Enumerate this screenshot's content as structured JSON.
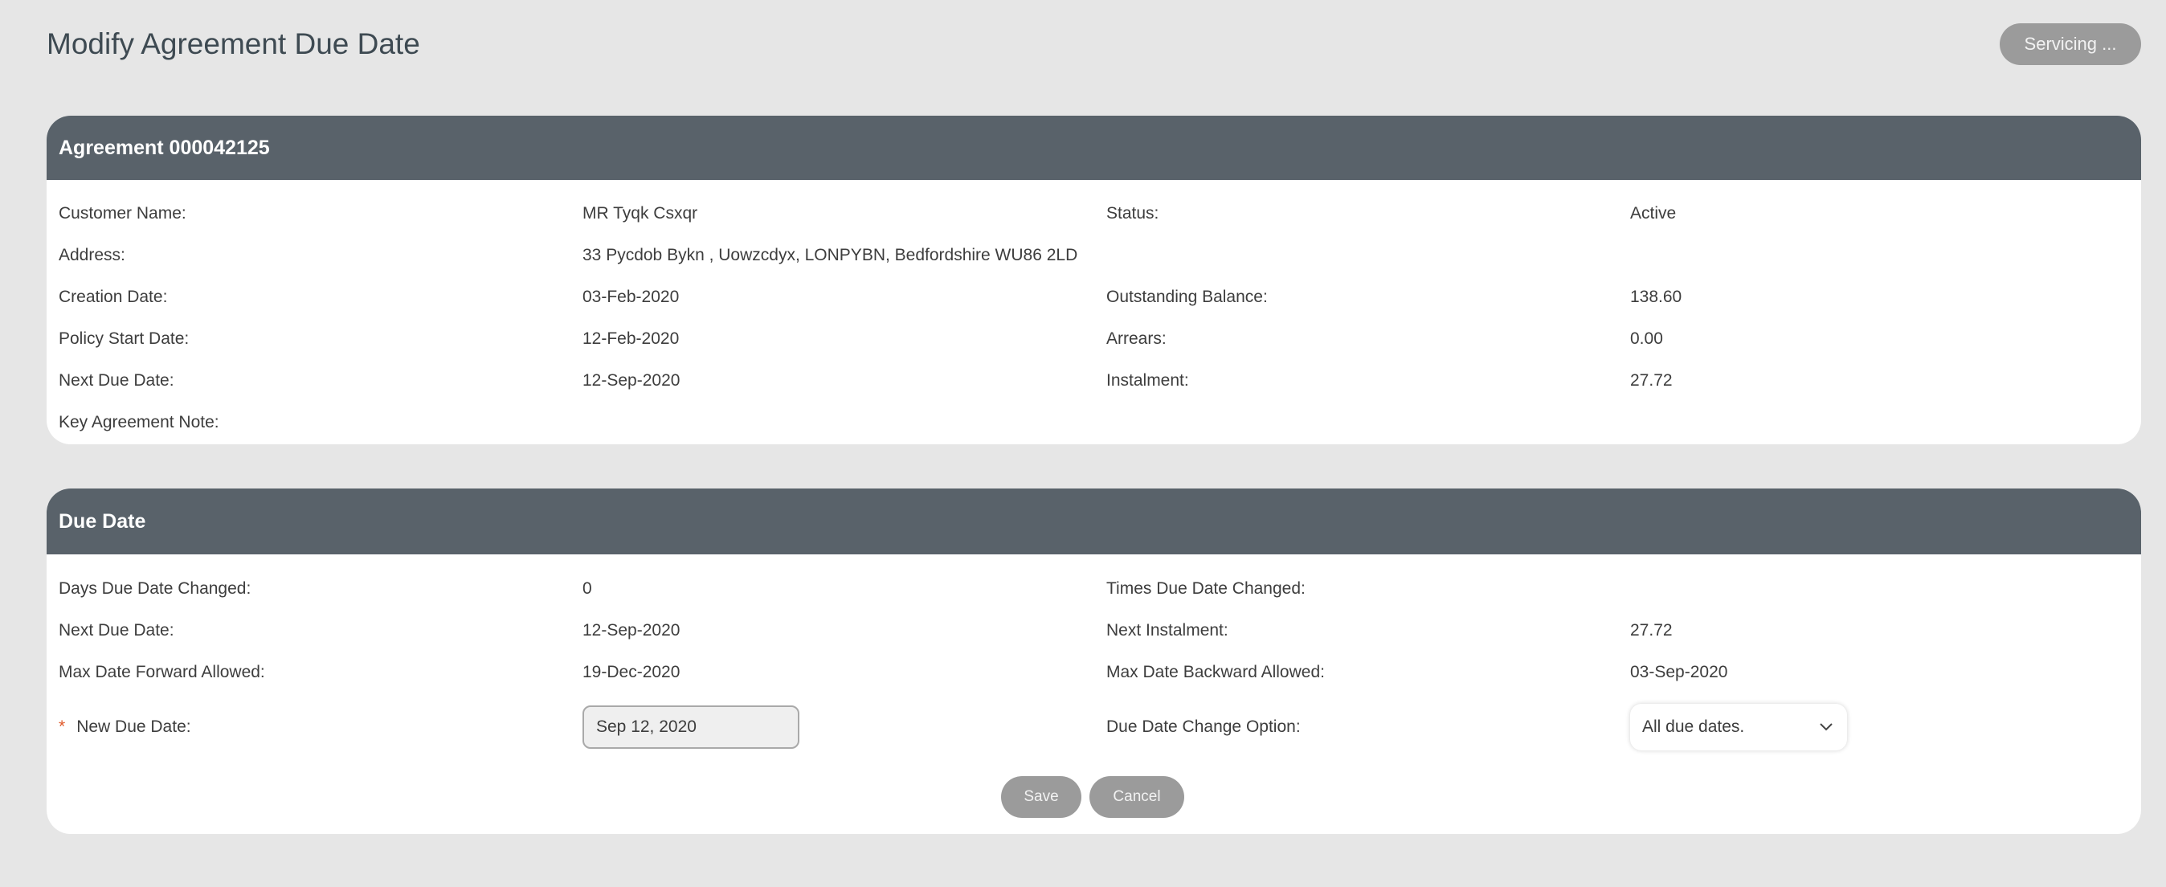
{
  "page": {
    "title": "Modify Agreement Due Date",
    "servicing_label": "Servicing ..."
  },
  "agreement": {
    "header": "Agreement 000042125",
    "customer_name_label": "Customer Name:",
    "customer_name": "MR Tyqk Csxqr",
    "status_label": "Status:",
    "status": "Active",
    "address_label": "Address:",
    "address": "33 Pycdob Bykn , Uowzcdyx, LONPYBN, Bedfordshire WU86 2LD",
    "creation_date_label": "Creation Date:",
    "creation_date": "03-Feb-2020",
    "outstanding_balance_label": "Outstanding Balance:",
    "outstanding_balance": "138.60",
    "policy_start_date_label": "Policy Start Date:",
    "policy_start_date": "12-Feb-2020",
    "arrears_label": "Arrears:",
    "arrears": "0.00",
    "next_due_date_label": "Next Due Date:",
    "next_due_date": "12-Sep-2020",
    "instalment_label": "Instalment:",
    "instalment": "27.72",
    "key_note_label": "Key Agreement Note:"
  },
  "due_date": {
    "header": "Due Date",
    "days_changed_label": "Days Due Date Changed:",
    "days_changed": "0",
    "times_changed_label": "Times Due Date Changed:",
    "next_due_date_label": "Next Due Date:",
    "next_due_date": "12-Sep-2020",
    "next_instalment_label": "Next Instalment:",
    "next_instalment": "27.72",
    "max_forward_label": "Max Date Forward Allowed:",
    "max_forward": "19-Dec-2020",
    "max_backward_label": "Max Date Backward Allowed:",
    "max_backward": "03-Sep-2020",
    "required_marker": "*",
    "new_due_date_label": "New Due Date:",
    "new_due_date_value": "Sep 12, 2020",
    "change_option_label": "Due Date Change Option:",
    "change_option_value": "All due dates.",
    "save_label": "Save",
    "cancel_label": "Cancel"
  },
  "colors": {
    "background": "#e6e6e6",
    "panel_header": "#59626a",
    "button": "#9b9b9b",
    "required": "#e05a2b"
  },
  "icons": {
    "select_chevron": "chevron-down-icon"
  }
}
